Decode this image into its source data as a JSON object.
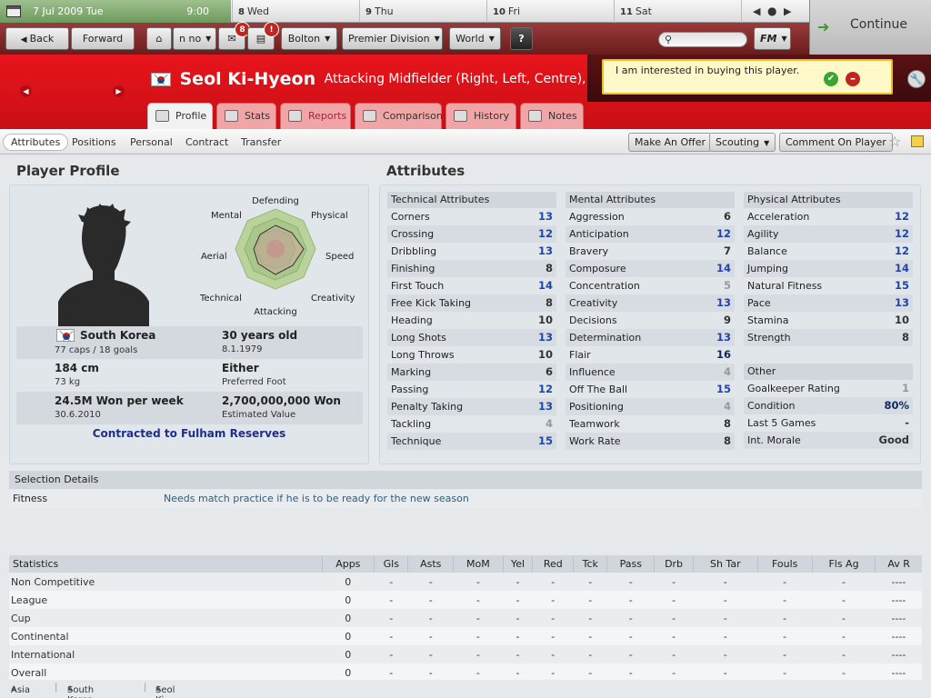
{
  "calendar": {
    "today_date": "7 Jul 2009",
    "today_day": "Tue",
    "time": "9:00",
    "days": [
      {
        "num": "8",
        "name": "Wed"
      },
      {
        "num": "9",
        "name": "Thu"
      },
      {
        "num": "10",
        "name": "Fri"
      },
      {
        "num": "11",
        "name": "Sat"
      }
    ]
  },
  "toolbar": {
    "back": "Back",
    "forward": "Forward",
    "manager": "n no",
    "inbox_badge": "8",
    "alert_badge": "!",
    "club": "Bolton",
    "competition": "Premier Division",
    "world": "World",
    "help": "?",
    "fm": "FM",
    "continue": "Continue"
  },
  "player": {
    "name": "Seol Ki-Hyeon",
    "position": "Attacking Midfielder (Right, Left, Centre), Forward"
  },
  "interest": {
    "message": "I am interested in buying this player."
  },
  "tabs": [
    {
      "label": "Profile"
    },
    {
      "label": "Stats"
    },
    {
      "label": "Reports"
    },
    {
      "label": "Comparison"
    },
    {
      "label": "History"
    },
    {
      "label": "Notes"
    }
  ],
  "subnav": {
    "items": [
      "Attributes",
      "Positions",
      "Personal",
      "Contract",
      "Transfer"
    ],
    "make_offer": "Make An Offer",
    "scouting": "Scouting",
    "comment": "Comment On Player"
  },
  "profile": {
    "title": "Player Profile",
    "radar_labels": [
      "Defending",
      "Physical",
      "Speed",
      "Creativity",
      "Attacking",
      "Technical",
      "Aerial",
      "Mental"
    ],
    "nation": "South Korea",
    "caps": "77 caps / 18 goals",
    "age": "30 years old",
    "dob": "8.1.1979",
    "height": "184 cm",
    "weight": "73 kg",
    "foot": "Either",
    "foot_label": "Preferred Foot",
    "wage": "24.5M Won per week",
    "contract_end": "30.6.2010",
    "value": "2,700,000,000 Won",
    "value_label": "Estimated Value",
    "contracted": "Contracted to Fulham Reserves"
  },
  "attributes": {
    "title": "Attributes",
    "technical": {
      "header": "Technical Attributes",
      "rows": [
        {
          "name": "Corners",
          "value": "13"
        },
        {
          "name": "Crossing",
          "value": "12"
        },
        {
          "name": "Dribbling",
          "value": "13"
        },
        {
          "name": "Finishing",
          "value": "8"
        },
        {
          "name": "First Touch",
          "value": "14"
        },
        {
          "name": "Free Kick Taking",
          "value": "8"
        },
        {
          "name": "Heading",
          "value": "10"
        },
        {
          "name": "Long Shots",
          "value": "13"
        },
        {
          "name": "Long Throws",
          "value": "10"
        },
        {
          "name": "Marking",
          "value": "6"
        },
        {
          "name": "Passing",
          "value": "12"
        },
        {
          "name": "Penalty Taking",
          "value": "13"
        },
        {
          "name": "Tackling",
          "value": "4"
        },
        {
          "name": "Technique",
          "value": "15"
        }
      ]
    },
    "mental": {
      "header": "Mental Attributes",
      "rows": [
        {
          "name": "Aggression",
          "value": "6"
        },
        {
          "name": "Anticipation",
          "value": "12"
        },
        {
          "name": "Bravery",
          "value": "7"
        },
        {
          "name": "Composure",
          "value": "14"
        },
        {
          "name": "Concentration",
          "value": "5"
        },
        {
          "name": "Creativity",
          "value": "13"
        },
        {
          "name": "Decisions",
          "value": "9"
        },
        {
          "name": "Determination",
          "value": "13"
        },
        {
          "name": "Flair",
          "value": "16"
        },
        {
          "name": "Influence",
          "value": "4"
        },
        {
          "name": "Off The Ball",
          "value": "15"
        },
        {
          "name": "Positioning",
          "value": "4"
        },
        {
          "name": "Teamwork",
          "value": "8"
        },
        {
          "name": "Work Rate",
          "value": "8"
        }
      ]
    },
    "physical": {
      "header": "Physical Attributes",
      "rows": [
        {
          "name": "Acceleration",
          "value": "12"
        },
        {
          "name": "Agility",
          "value": "12"
        },
        {
          "name": "Balance",
          "value": "12"
        },
        {
          "name": "Jumping",
          "value": "14"
        },
        {
          "name": "Natural Fitness",
          "value": "15"
        },
        {
          "name": "Pace",
          "value": "13"
        },
        {
          "name": "Stamina",
          "value": "10"
        },
        {
          "name": "Strength",
          "value": "8"
        }
      ]
    },
    "other": {
      "header": "Other",
      "rows": [
        {
          "name": "Goalkeeper Rating",
          "value": "1"
        },
        {
          "name": "Condition",
          "value": "80%"
        },
        {
          "name": "Last 5 Games",
          "value": "-"
        },
        {
          "name": "Int. Morale",
          "value": "Good"
        }
      ]
    }
  },
  "selection": {
    "header": "Selection Details",
    "label": "Fitness",
    "message": "Needs match practice if he is to be ready for the new season"
  },
  "statistics": {
    "columns": [
      "Statistics",
      "Apps",
      "Gls",
      "Asts",
      "MoM",
      "Yel",
      "Red",
      "Tck",
      "Pass",
      "Drb",
      "Sh Tar",
      "Fouls",
      "Fls Ag",
      "Av R"
    ],
    "rows": [
      [
        "Non Competitive",
        "0",
        "-",
        "-",
        "-",
        "-",
        "-",
        "-",
        "-",
        "-",
        "-",
        "-",
        "-",
        "----"
      ],
      [
        "League",
        "0",
        "-",
        "-",
        "-",
        "-",
        "-",
        "-",
        "-",
        "-",
        "-",
        "-",
        "-",
        "----"
      ],
      [
        "Cup",
        "0",
        "-",
        "-",
        "-",
        "-",
        "-",
        "-",
        "-",
        "-",
        "-",
        "-",
        "-",
        "----"
      ],
      [
        "Continental",
        "0",
        "-",
        "-",
        "-",
        "-",
        "-",
        "-",
        "-",
        "-",
        "-",
        "-",
        "-",
        "----"
      ],
      [
        "International",
        "0",
        "-",
        "-",
        "-",
        "-",
        "-",
        "-",
        "-",
        "-",
        "-",
        "-",
        "-",
        "----"
      ],
      [
        "Overall",
        "0",
        "-",
        "-",
        "-",
        "-",
        "-",
        "-",
        "-",
        "-",
        "-",
        "-",
        "-",
        "----"
      ]
    ]
  },
  "breadcrumbs": [
    "Asia",
    "South Korea",
    "Seol Ki-Hyeon"
  ]
}
